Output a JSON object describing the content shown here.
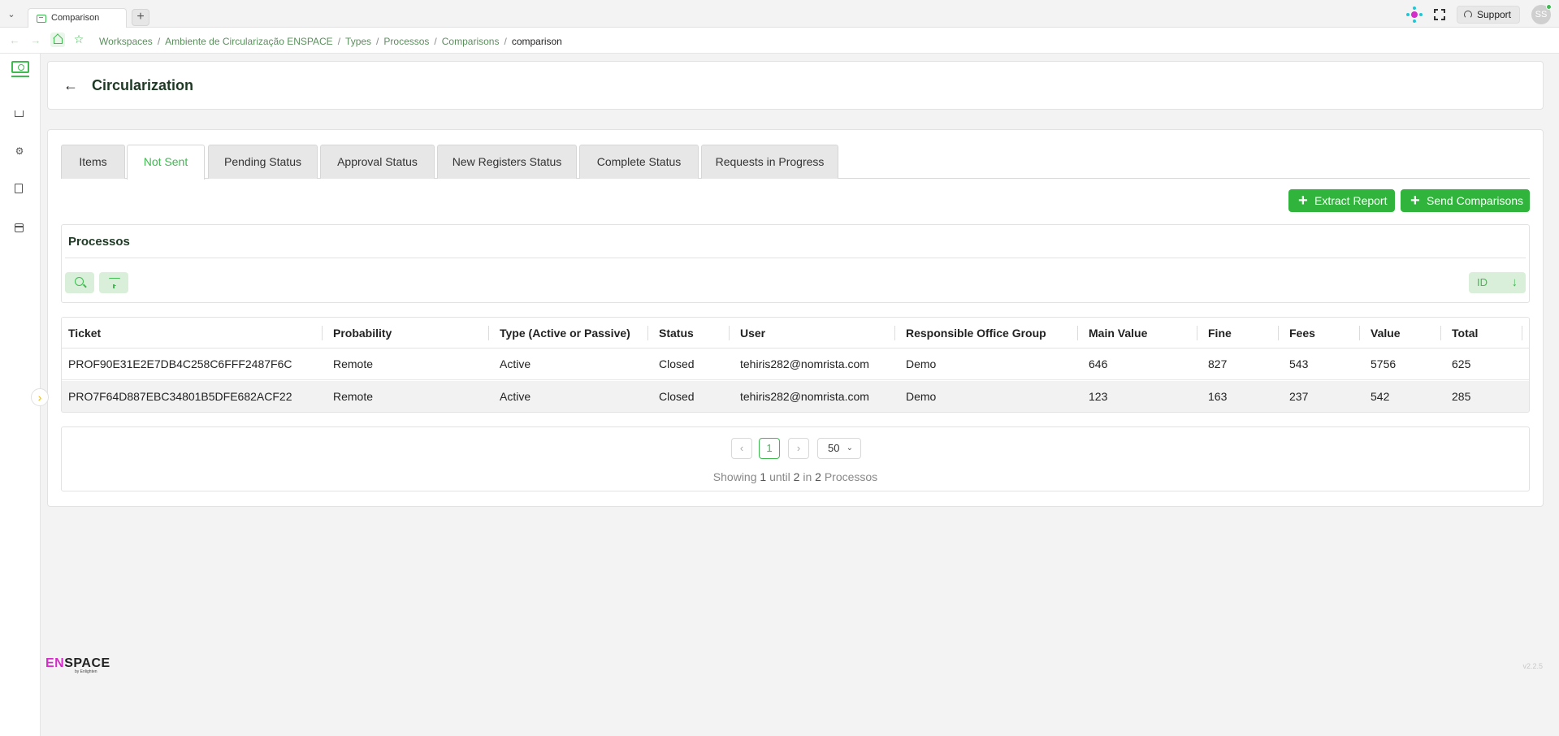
{
  "browser": {
    "tab_title": "Comparison",
    "new_tab_label": "+"
  },
  "topbar": {
    "support_label": "Support",
    "avatar_initials": "SS"
  },
  "breadcrumb": {
    "items": [
      "Workspaces",
      "Ambiente de Circularização ENSPACE",
      "Types",
      "Processos",
      "Comparisons"
    ],
    "current": "comparison",
    "separator": "/"
  },
  "header": {
    "title": "Circularization"
  },
  "tabs": [
    {
      "label": "Items",
      "active": false
    },
    {
      "label": "Not Sent",
      "active": true
    },
    {
      "label": "Pending Status",
      "active": false
    },
    {
      "label": "Approval Status",
      "active": false
    },
    {
      "label": "New Registers Status",
      "active": false
    },
    {
      "label": "Complete Status",
      "active": false
    },
    {
      "label": "Requests in Progress",
      "active": false
    }
  ],
  "actions": {
    "extract_report": "Extract Report",
    "send_comparisons": "Send Comparisons"
  },
  "processos": {
    "title": "Processos",
    "sort_label": "ID"
  },
  "table": {
    "columns": [
      "Ticket",
      "Probability",
      "Type (Active or Passive)",
      "Status",
      "User",
      "Responsible Office Group",
      "Main Value",
      "Fine",
      "Fees",
      "Value",
      "Total"
    ],
    "rows": [
      [
        "PROF90E31E2E7DB4C258C6FFF2487F6C",
        "Remote",
        "Active",
        "Closed",
        "tehiris282@nomrista.com",
        "Demo",
        "646",
        "827",
        "543",
        "5756",
        "625"
      ],
      [
        "PRO7F64D887EBC34801B5DFE682ACF22",
        "Remote",
        "Active",
        "Closed",
        "tehiris282@nomrista.com",
        "Demo",
        "123",
        "163",
        "237",
        "542",
        "285"
      ]
    ]
  },
  "pagination": {
    "current_page": "1",
    "page_size": "50",
    "info_prefix": "Showing",
    "from": "1",
    "until_word": "until",
    "to": "2",
    "in_word": "in",
    "total": "2",
    "entity": "Processos"
  },
  "footer": {
    "brand_en": "EN",
    "brand_space": "SPACE",
    "brand_sub": "by Enlighten",
    "version": "v2.2.5"
  },
  "colors": {
    "accent": "#3fb950",
    "button": "#30b43c",
    "brand_magenta": "#d42cc8"
  }
}
